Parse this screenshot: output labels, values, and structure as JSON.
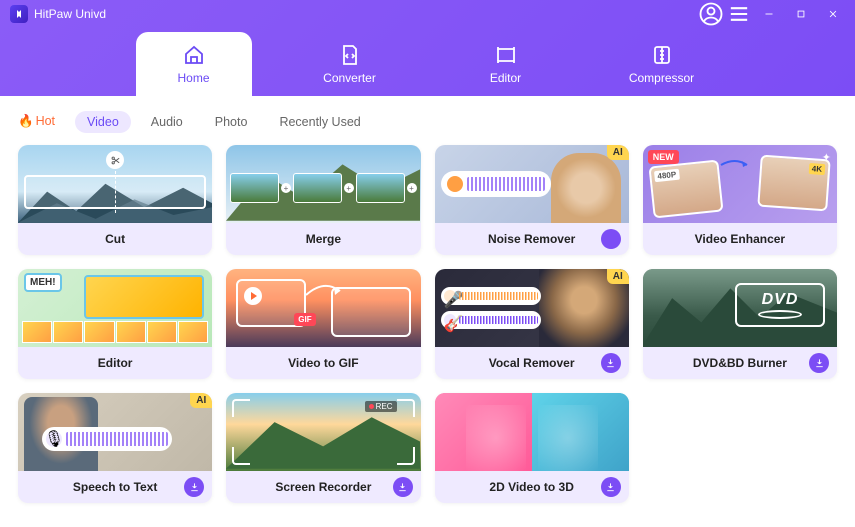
{
  "app": {
    "title": "HitPaw Univd"
  },
  "nav": {
    "items": [
      {
        "label": "Home"
      },
      {
        "label": "Converter"
      },
      {
        "label": "Editor"
      },
      {
        "label": "Compressor"
      }
    ]
  },
  "filters": {
    "hot": "Hot",
    "items": [
      {
        "label": "Video"
      },
      {
        "label": "Audio"
      },
      {
        "label": "Photo"
      },
      {
        "label": "Recently Used"
      }
    ]
  },
  "cards": {
    "cut": {
      "title": "Cut"
    },
    "merge": {
      "title": "Merge"
    },
    "noise": {
      "title": "Noise Remover",
      "ai": "AI"
    },
    "enhancer": {
      "title": "Video Enhancer",
      "new": "NEW",
      "tag_low": "480P",
      "tag_high": "4K"
    },
    "editor": {
      "title": "Editor",
      "meh": "MEH!"
    },
    "gif": {
      "title": "Video to GIF",
      "badge": "GIF"
    },
    "vocal": {
      "title": "Vocal Remover",
      "ai": "AI"
    },
    "dvd": {
      "title": "DVD&BD Burner",
      "logo": "DVD"
    },
    "stt": {
      "title": "Speech to Text",
      "ai": "AI"
    },
    "recorder": {
      "title": "Screen Recorder",
      "rec": "REC"
    },
    "v3d": {
      "title": "2D Video to 3D"
    }
  }
}
